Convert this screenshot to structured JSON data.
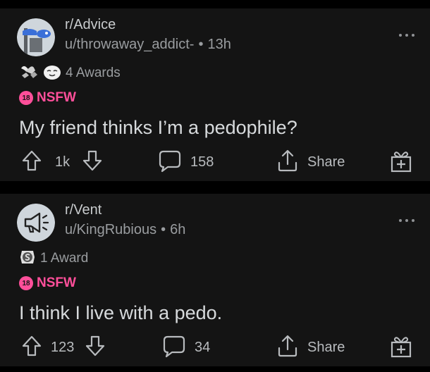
{
  "posts": [
    {
      "subreddit": "r/Advice",
      "user": "u/throwaway_addict-",
      "time": "13h",
      "awards_label": "4 Awards",
      "nsfw_badge": "18",
      "nsfw_label": "NSFW",
      "title": "My friend thinks I’m a pedophile?",
      "votes": "1k",
      "comments": "158",
      "share_label": "Share"
    },
    {
      "subreddit": "r/Vent",
      "user": "u/KingRubious",
      "time": "6h",
      "awards_label": "1 Award",
      "nsfw_badge": "18",
      "nsfw_label": "NSFW",
      "title": "I think I live with a pedo.",
      "votes": "123",
      "comments": "34",
      "share_label": "Share"
    }
  ],
  "icons": {
    "post1_avatar": "advice-subreddit-avatar-icon",
    "post2_avatar": "megaphone-subreddit-avatar-icon",
    "upvote": "arrow-up-icon",
    "downvote": "arrow-down-icon",
    "comment": "speech-bubble-icon",
    "share": "share-icon",
    "gift": "gift-icon",
    "more": "ellipsis-icon"
  },
  "colors": {
    "background": "#000000",
    "card": "#141414",
    "nsfw": "#ff4f9a",
    "text_primary": "#d7dadc",
    "text_secondary": "#9a9da0"
  }
}
